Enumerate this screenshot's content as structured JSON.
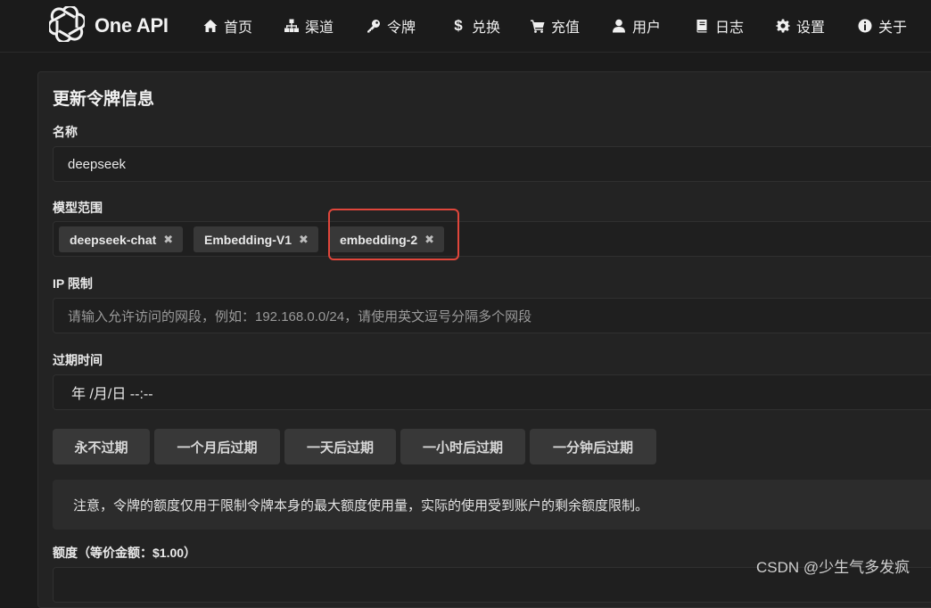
{
  "app": {
    "name": "One API"
  },
  "nav": [
    {
      "label": "首页",
      "icon": "home-icon"
    },
    {
      "label": "渠道",
      "icon": "sitemap-icon"
    },
    {
      "label": "令牌",
      "icon": "key-icon"
    },
    {
      "label": "兑换",
      "icon": "dollar-icon"
    },
    {
      "label": "充值",
      "icon": "cart-icon"
    },
    {
      "label": "用户",
      "icon": "user-icon"
    },
    {
      "label": "日志",
      "icon": "book-icon"
    },
    {
      "label": "设置",
      "icon": "gear-icon"
    },
    {
      "label": "关于",
      "icon": "info-icon"
    }
  ],
  "form": {
    "title": "更新令牌信息",
    "name_label": "名称",
    "name_value": "deepseek",
    "models_label": "模型范围",
    "models": [
      "deepseek-chat",
      "Embedding-V1",
      "embedding-2"
    ],
    "chip_remove_glyph": "✖",
    "ip_label": "IP 限制",
    "ip_placeholder": "请输入允许访问的网段，例如：192.168.0.0/24，请使用英文逗号分隔多个网段",
    "expire_label": "过期时间",
    "expire_value": "年 /月/日 --:--",
    "expire_buttons": [
      "永不过期",
      "一个月后过期",
      "一天后过期",
      "一小时后过期",
      "一分钟后过期"
    ],
    "note": "注意，令牌的额度仅用于限制令牌本身的最大额度使用量，实际的使用受到账户的剩余额度限制。",
    "quota_label": "额度（等价金额：$1.00）"
  },
  "watermark": "CSDN @少生气多发疯",
  "colors": {
    "background": "#1b1b1b",
    "highlight": "#e0463b"
  }
}
